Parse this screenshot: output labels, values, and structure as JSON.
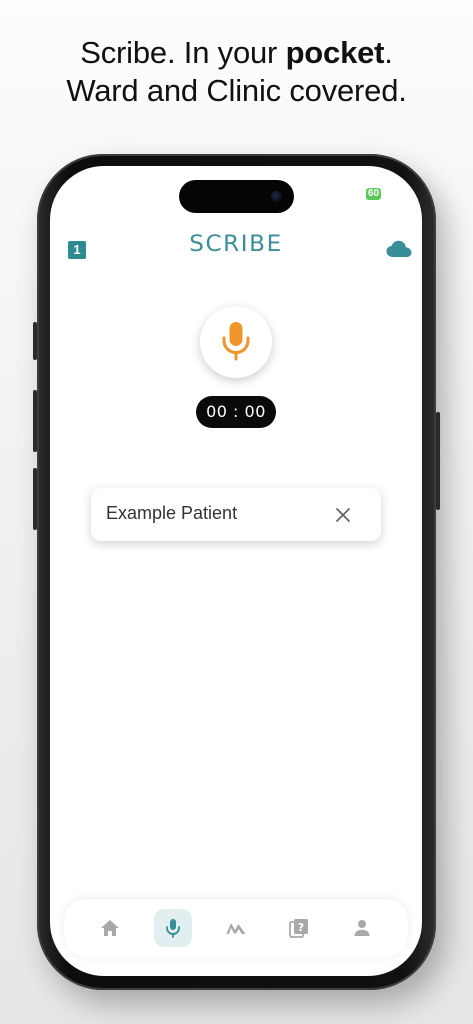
{
  "headline": {
    "line1_prefix": "Scribe. In your ",
    "line1_bold": "pocket",
    "line1_suffix": ".",
    "line2": "Ward and Clinic covered."
  },
  "status_bar": {
    "battery": "60"
  },
  "header": {
    "badge_count": "1",
    "logo": "SCRIBE",
    "cloud_icon": "cloud-icon"
  },
  "recorder": {
    "mic_icon": "microphone-icon",
    "timer": "00 : 00"
  },
  "patient": {
    "name": "Example Patient",
    "close_icon": "close-icon"
  },
  "bottom_nav": {
    "items": [
      {
        "icon": "home-icon",
        "active": false
      },
      {
        "icon": "microphone-icon",
        "active": true
      },
      {
        "icon": "mountain-icon",
        "active": false
      },
      {
        "icon": "help-book-icon",
        "active": false
      },
      {
        "icon": "person-icon",
        "active": false
      }
    ]
  },
  "colors": {
    "accent": "#3a8e97",
    "mic": "#f0952a",
    "nav_icon": "#a9a9a9",
    "nav_active_icon": "#3a8e97",
    "nav_active_bg": "#e1eff0",
    "battery": "#5bc95b"
  }
}
